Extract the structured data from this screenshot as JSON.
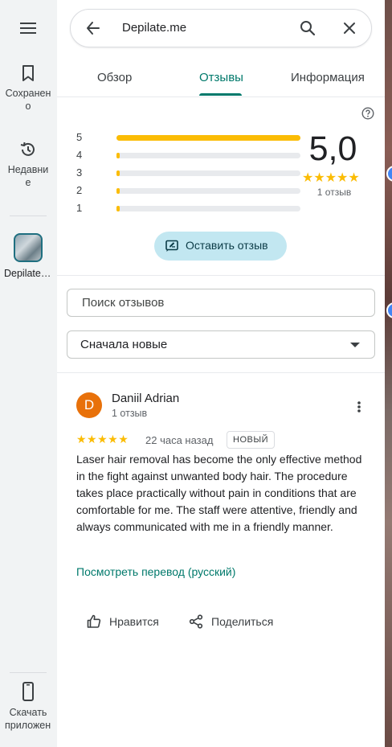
{
  "rail": {
    "saved_label": "Сохранено",
    "recent_label": "Недавние",
    "place_label": "Depilate.me",
    "download_label": "Скачать приложение"
  },
  "search": {
    "query": "Depilate.me"
  },
  "tabs": [
    {
      "label": "Обзор"
    },
    {
      "label": "Отзывы"
    },
    {
      "label": "Информация"
    }
  ],
  "rating": {
    "score": "5,0",
    "count": "1 отзыв",
    "distribution": [
      {
        "stars": "5",
        "fraction": 1.0
      },
      {
        "stars": "4",
        "fraction": 0
      },
      {
        "stars": "3",
        "fraction": 0
      },
      {
        "stars": "2",
        "fraction": 0
      },
      {
        "stars": "1",
        "fraction": 0
      }
    ],
    "stars": 5
  },
  "write_review_label": "Оставить отзыв",
  "review_search": {
    "placeholder": "Поиск отзывов"
  },
  "sort": {
    "value": "Сначала новые"
  },
  "review": {
    "avatar_letter": "D",
    "author": "Daniil Adrian",
    "author_reviews": "1 отзыв",
    "stars": 5,
    "time": "22 часа назад",
    "badge": "НОВЫЙ",
    "text": "Laser hair removal has become the only effective method in the fight against unwanted body hair. The procedure takes place practically without pain in conditions that are comfortable for me. The staff were attentive, friendly and always communicated with me in a friendly manner.",
    "translate_link": "Посмотреть перевод (русский)",
    "like_label": "Нравится",
    "share_label": "Поделиться"
  },
  "colors": {
    "accent": "#00796b",
    "star": "#fbbc04",
    "avatar": "#e8710a",
    "button_bg": "#c2e7f1"
  },
  "icons": [
    "menu-icon",
    "bookmark-icon",
    "history-icon",
    "phone-icon",
    "back-arrow-icon",
    "search-icon",
    "close-icon",
    "help-icon",
    "write-review-icon",
    "more-vert-icon",
    "thumb-up-icon",
    "share-icon"
  ]
}
